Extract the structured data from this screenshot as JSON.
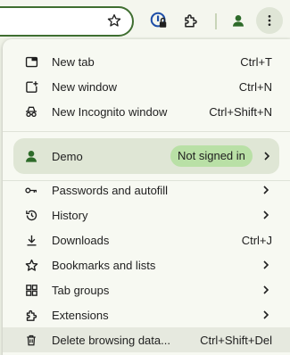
{
  "menu": {
    "new_tab": {
      "label": "New tab",
      "shortcut": "Ctrl+T",
      "icon": "new-tab-icon"
    },
    "new_window": {
      "label": "New window",
      "shortcut": "Ctrl+N",
      "icon": "new-window-icon"
    },
    "new_incognito": {
      "label": "New Incognito window",
      "shortcut": "Ctrl+Shift+N",
      "icon": "incognito-icon"
    },
    "profile": {
      "name": "Demo",
      "status": "Not signed in",
      "icon": "person-icon"
    },
    "passwords": {
      "label": "Passwords and autofill",
      "icon": "key-icon"
    },
    "history": {
      "label": "History",
      "icon": "history-icon"
    },
    "downloads": {
      "label": "Downloads",
      "shortcut": "Ctrl+J",
      "icon": "download-icon"
    },
    "bookmarks": {
      "label": "Bookmarks and lists",
      "icon": "star-icon"
    },
    "tab_groups": {
      "label": "Tab groups",
      "icon": "tab-groups-icon"
    },
    "extensions": {
      "label": "Extensions",
      "icon": "puzzle-icon"
    },
    "delete_data": {
      "label": "Delete browsing data...",
      "shortcut": "Ctrl+Shift+Del",
      "icon": "trash-icon"
    }
  },
  "colors": {
    "accent": "#3f6e30",
    "badge": "#b9e0a6",
    "menu_bg": "#f7f9f2"
  }
}
